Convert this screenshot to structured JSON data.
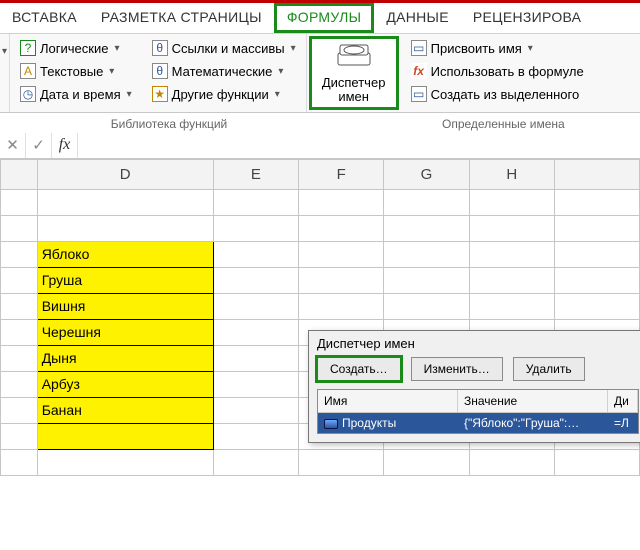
{
  "ribbon": {
    "tabs": [
      "ВСТАВКА",
      "РАЗМЕТКА СТРАНИЦЫ",
      "ФОРМУЛЫ",
      "ДАННЫЕ",
      "РЕЦЕНЗИРОВА"
    ],
    "active": 2,
    "groups": {
      "lib": {
        "btns": [
          {
            "icon": "?",
            "label": "Логические"
          },
          {
            "icon": "A",
            "label": "Текстовые"
          },
          {
            "icon": "⏲",
            "label": "Дата и время"
          }
        ],
        "btns2": [
          {
            "icon": "θ",
            "label": "Ссылки и массивы"
          },
          {
            "icon": "θ",
            "label": "Математические"
          },
          {
            "icon": "★",
            "label": "Другие функции"
          }
        ],
        "label": "Библиотека функций"
      },
      "name_mgr": {
        "big": "Диспетчер имен"
      },
      "defined": {
        "btns": [
          {
            "icon": "▭",
            "label": "Присвоить имя"
          },
          {
            "icon": "fx",
            "label": "Использовать в формуле"
          },
          {
            "icon": "▭",
            "label": "Создать из выделенного"
          }
        ],
        "label": "Определенные имена"
      }
    }
  },
  "formula_bar": {
    "cancel": "✕",
    "confirm": "✓",
    "fx": "fx",
    "value": ""
  },
  "columns": [
    "",
    "D",
    "E",
    "F",
    "G",
    "H"
  ],
  "cells": {
    "fruits": [
      "Яблоко",
      "Груша",
      "Вишня",
      "Черешня",
      "Дыня",
      "Арбуз",
      "Банан"
    ]
  },
  "dialog": {
    "title": "Диспетчер имен",
    "buttons": {
      "create": "Создать…",
      "edit": "Изменить…",
      "del": "Удалить"
    },
    "headers": {
      "name": "Имя",
      "value": "Значение",
      "d": "Ди"
    },
    "row": {
      "name": "Продукты",
      "value": "{\"Яблоко\":\"Груша\":…",
      "d": "=Л"
    }
  }
}
